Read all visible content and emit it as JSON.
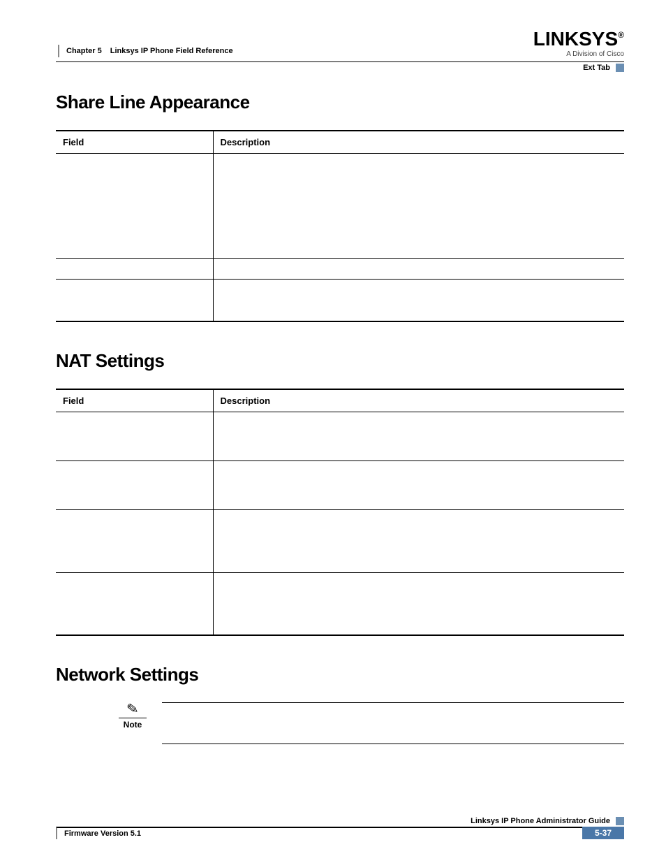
{
  "header": {
    "chapter_label": "Chapter 5",
    "chapter_title": "Linksys IP Phone Field Reference",
    "logo_text": "LINKSYS",
    "logo_tm": "®",
    "logo_sub": "A Division of Cisco",
    "tab_label": "Ext Tab"
  },
  "sections": {
    "share_line": {
      "title": "Share Line Appearance",
      "col_field": "Field",
      "col_desc": "Description",
      "rows": [
        {
          "field": "",
          "desc": ""
        },
        {
          "field": "",
          "desc": ""
        },
        {
          "field": "",
          "desc": ""
        }
      ]
    },
    "nat": {
      "title": "NAT Settings",
      "col_field": "Field",
      "col_desc": "Description",
      "rows": [
        {
          "field": "",
          "desc": ""
        },
        {
          "field": "",
          "desc": ""
        },
        {
          "field": "",
          "desc": ""
        },
        {
          "field": "",
          "desc": ""
        }
      ]
    },
    "network": {
      "title": "Network Settings",
      "note_label": "Note",
      "note_text": ""
    }
  },
  "footer": {
    "guide_title": "Linksys IP Phone Administrator Guide",
    "firmware": "Firmware Version 5.1",
    "page_number": "5-37"
  }
}
